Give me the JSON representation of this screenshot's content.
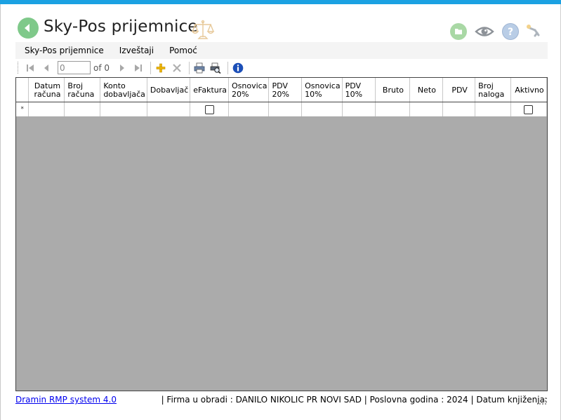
{
  "header": {
    "title": "Sky-Pos prijemnice"
  },
  "menu": {
    "items": [
      "Sky-Pos prijemnice",
      "Izveštaji",
      "Pomoć"
    ]
  },
  "toolbar": {
    "position_value": "0",
    "of_label": "of 0"
  },
  "grid": {
    "columns": [
      {
        "label": "Datum\nračuna",
        "type": "text"
      },
      {
        "label": "Broj\nračuna",
        "type": "text"
      },
      {
        "label": "Konto\ndobavljača",
        "type": "text"
      },
      {
        "label": "Dobavljač",
        "type": "text"
      },
      {
        "label": "eFaktura",
        "type": "checkbox"
      },
      {
        "label": "Osnovica\n20%",
        "type": "text"
      },
      {
        "label": "PDV\n20%",
        "type": "text"
      },
      {
        "label": "Osnovica\n10%",
        "type": "text"
      },
      {
        "label": "PDV\n10%",
        "type": "text"
      },
      {
        "label": "Bruto",
        "type": "text"
      },
      {
        "label": "Neto",
        "type": "text"
      },
      {
        "label": "PDV",
        "type": "text"
      },
      {
        "label": "Broj\nnaloga",
        "type": "text"
      },
      {
        "label": "Aktivno",
        "type": "checkbox"
      }
    ],
    "new_row_marker": "*"
  },
  "status": {
    "link": "Dramin RMP system 4.0",
    "info": "|  Firma u obradi : DANILO NIKOLIC PR NOVI SAD  |  Poslovna godina : 2024  |  Datum knjiženja:"
  },
  "colors": {
    "accent": "#1ba1e2",
    "back_button": "#7fc98a",
    "grid_background": "#ababab"
  },
  "icons": [
    "back-arrow-icon",
    "scales-icon",
    "folder-icon",
    "eye-icon",
    "help-icon",
    "key-icon",
    "first-record-icon",
    "previous-record-icon",
    "next-record-icon",
    "last-record-icon",
    "add-icon",
    "delete-icon",
    "print-icon",
    "print-preview-icon",
    "info-icon",
    "size-grip-icon"
  ]
}
